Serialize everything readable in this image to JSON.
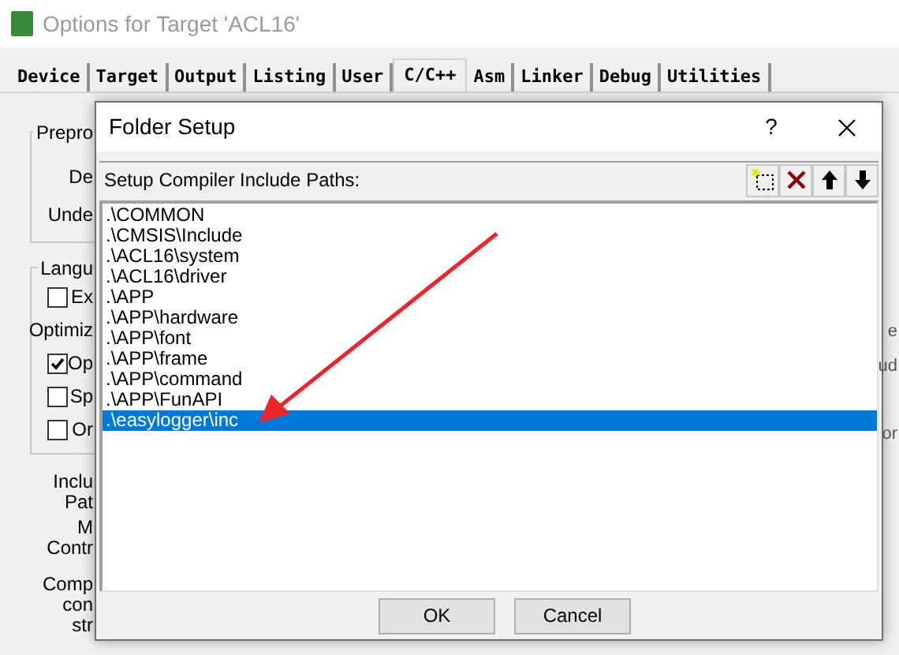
{
  "window": {
    "title": "Options for Target 'ACL16'"
  },
  "tabs": [
    {
      "label": "Device",
      "selected": false
    },
    {
      "label": "Target",
      "selected": false
    },
    {
      "label": "Output",
      "selected": false
    },
    {
      "label": "Listing",
      "selected": false
    },
    {
      "label": "User",
      "selected": false
    },
    {
      "label": "C/C++",
      "selected": true
    },
    {
      "label": "Asm",
      "selected": false
    },
    {
      "label": "Linker",
      "selected": false
    },
    {
      "label": "Debug",
      "selected": false
    },
    {
      "label": "Utilities",
      "selected": false
    }
  ],
  "preprocessor_group": {
    "title": "Prepro",
    "labels": [
      "De",
      "Unde"
    ]
  },
  "language_group": {
    "title": "Langu",
    "options": [
      {
        "kind": "checkbox",
        "label": "Ex",
        "checked": false
      },
      {
        "kind": "label",
        "label": "Optimiz"
      },
      {
        "kind": "checkbox",
        "label": "Op",
        "checked": true
      },
      {
        "kind": "checkbox",
        "label": "Sp",
        "checked": false
      },
      {
        "kind": "checkbox",
        "label": "Or",
        "checked": false
      }
    ]
  },
  "side_labels": [
    {
      "lines": [
        "Inclu",
        "Pat"
      ]
    },
    {
      "lines": [
        "M",
        "Contr"
      ]
    },
    {
      "lines": [
        "Comp",
        "con",
        "str"
      ]
    }
  ],
  "right_edge_fragments": [
    "e",
    "ud",
    "or"
  ],
  "dialog": {
    "title": "Folder Setup",
    "help_button": "?",
    "list_header": "Setup Compiler Include Paths:",
    "toolbar": [
      {
        "kind": "new"
      },
      {
        "kind": "delete"
      },
      {
        "kind": "up"
      },
      {
        "kind": "down"
      }
    ],
    "paths": [
      {
        "text": ".\\COMMON",
        "selected": false
      },
      {
        "text": ".\\CMSIS\\Include",
        "selected": false
      },
      {
        "text": ".\\ACL16\\system",
        "selected": false
      },
      {
        "text": ".\\ACL16\\driver",
        "selected": false
      },
      {
        "text": ".\\APP",
        "selected": false
      },
      {
        "text": ".\\APP\\hardware",
        "selected": false
      },
      {
        "text": ".\\APP\\font",
        "selected": false
      },
      {
        "text": ".\\APP\\frame",
        "selected": false
      },
      {
        "text": ".\\APP\\command",
        "selected": false
      },
      {
        "text": ".\\APP\\FunAPI",
        "selected": false
      },
      {
        "text": ".\\easylogger\\inc",
        "selected": true
      }
    ],
    "buttons": [
      "OK",
      "Cancel"
    ]
  }
}
